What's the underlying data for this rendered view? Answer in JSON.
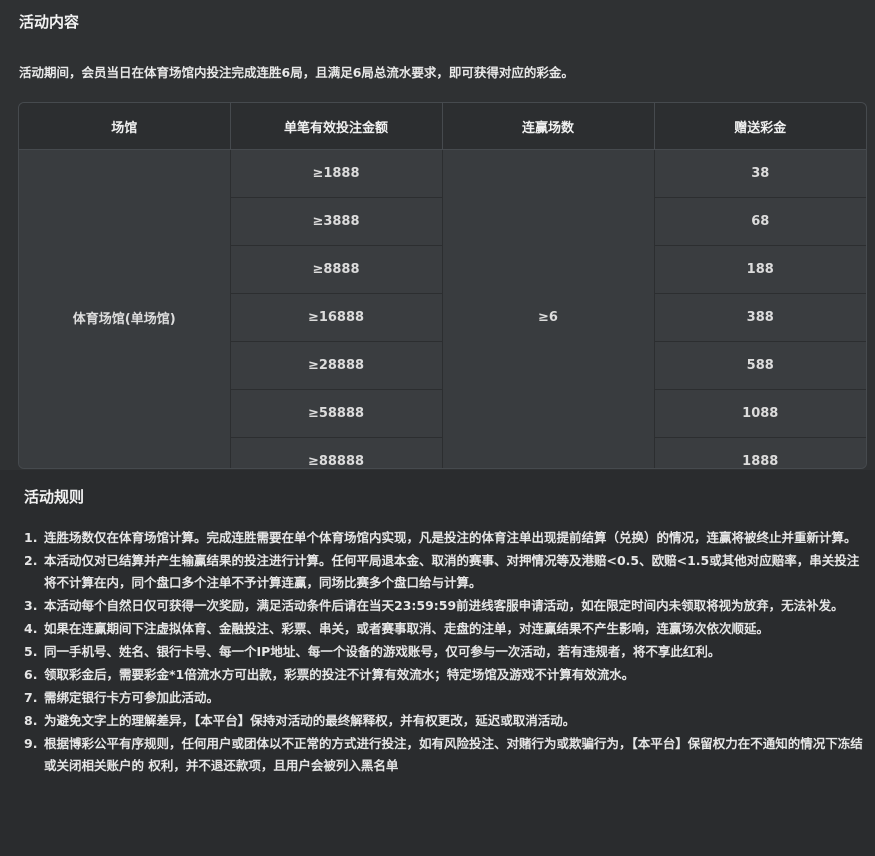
{
  "section_title": "活动内容",
  "intro": "活动期间，会员当日在体育场馆内投注完成连胜6局，且满足6局总流水要求，即可获得对应的彩金。",
  "table": {
    "headers": [
      "场馆",
      "单笔有效投注金额",
      "连赢场数",
      "赠送彩金"
    ],
    "venue": "体育场馆(单场馆)",
    "streak": "≥6",
    "rows": [
      {
        "bet": "≥1888",
        "bonus": "38"
      },
      {
        "bet": "≥3888",
        "bonus": "68"
      },
      {
        "bet": "≥8888",
        "bonus": "188"
      },
      {
        "bet": "≥16888",
        "bonus": "388"
      },
      {
        "bet": "≥28888",
        "bonus": "588"
      },
      {
        "bet": "≥58888",
        "bonus": "1088"
      },
      {
        "bet": "≥88888",
        "bonus": "1888"
      }
    ]
  },
  "rules_title": "活动规则",
  "rules": [
    {
      "num": "1.",
      "text": "连胜场数仅在体育场馆计算。完成连胜需要在单个体育场馆内实现，凡是投注的体育注单出现提前结算（兑换）的情况，连赢将被终止并重新计算。"
    },
    {
      "num": "2.",
      "text": "本活动仅对已结算并产生输赢结果的投注进行计算。任何平局退本金、取消的赛事、对押情况等及港赔<0.5、欧赔<1.5或其他对应赔率，串关投注将不计算在内，同个盘口多个注单不予计算连赢，同场比赛多个盘口给与计算。"
    },
    {
      "num": "3.",
      "text": "本活动每个自然日仅可获得一次奖励，满足活动条件后请在当天23:59:59前进线客服申请活动，如在限定时间内未领取将视为放弃，无法补发。"
    },
    {
      "num": "4.",
      "text": "如果在连赢期间下注虚拟体育、金融投注、彩票、串关，或者赛事取消、走盘的注单，对连赢结果不产生影响，连赢场次依次顺延。"
    },
    {
      "num": "5.",
      "text": "同一手机号、姓名、银行卡号、每一个IP地址、每一个设备的游戏账号，仅可参与一次活动，若有违规者，将不享此红利。"
    },
    {
      "num": "6.",
      "text": "领取彩金后，需要彩金*1倍流水方可出款，彩票的投注不计算有效流水；特定场馆及游戏不计算有效流水。"
    },
    {
      "num": "7.",
      "text": "需绑定银行卡方可参加此活动。"
    },
    {
      "num": "8.",
      "text": "为避免文字上的理解差异，【本平台】保持对活动的最终解释权，并有权更改，延迟或取消活动。"
    },
    {
      "num": "9.",
      "text": "根据博彩公平有序规则，任何用户或团体以不正常的方式进行投注，如有风险投注、对赌行为或欺骗行为，【本平台】保留权力在不通知的情况下冻结或关闭相关账户的 权利，并不退还款项，且用户会被列入黑名单"
    }
  ]
}
